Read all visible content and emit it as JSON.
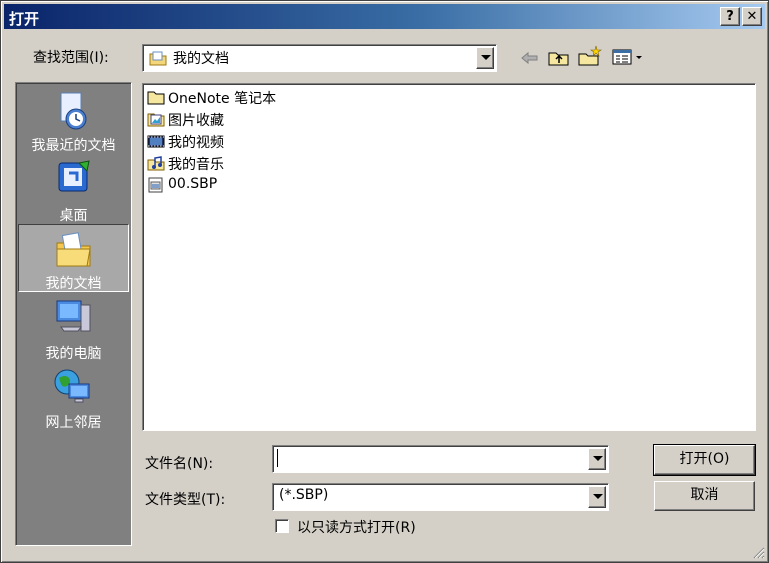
{
  "title": "打开",
  "titlebar": {
    "help": "?",
    "close": "✕"
  },
  "look_in": {
    "label": "查找范围(I):",
    "value": "我的文档"
  },
  "places": [
    {
      "label": "我最近的文档"
    },
    {
      "label": "桌面"
    },
    {
      "label": "我的文档"
    },
    {
      "label": "我的电脑"
    },
    {
      "label": "网上邻居"
    }
  ],
  "files": [
    {
      "name": "OneNote 笔记本",
      "icon": "folder-icon"
    },
    {
      "name": "图片收藏",
      "icon": "pictures-folder-icon"
    },
    {
      "name": "我的视频",
      "icon": "videos-folder-icon"
    },
    {
      "name": "我的音乐",
      "icon": "music-folder-icon"
    },
    {
      "name": "00.SBP",
      "icon": "file-icon"
    }
  ],
  "filename": {
    "label": "文件名(N):",
    "value": ""
  },
  "filetype": {
    "label": "文件类型(T):",
    "value": "(*.SBP)"
  },
  "readonly": {
    "label": "以只读方式打开(R)",
    "checked": false
  },
  "buttons": {
    "open": "打开(O)",
    "cancel": "取消"
  },
  "colors": {
    "title_start": "#0a246a",
    "title_end": "#a6caf0",
    "face": "#d4d0c8",
    "places_bg": "#808080"
  }
}
